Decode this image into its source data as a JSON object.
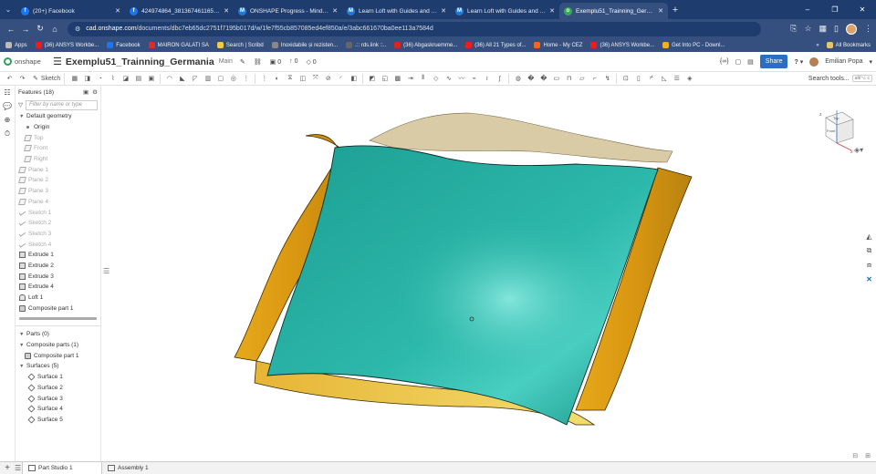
{
  "browser": {
    "tabs": [
      {
        "title": "(20+) Facebook",
        "icon": "facebook-icon",
        "color": "#1877f2",
        "glyph": "f",
        "active": false
      },
      {
        "title": "424974864_381367461165453...",
        "icon": "facebook-icon",
        "color": "#1877f2",
        "glyph": "f",
        "active": false
      },
      {
        "title": "ONSHAPE Progress - Mind Lum...",
        "icon": "mindluster-icon",
        "color": "#1f7ad8",
        "glyph": "M",
        "active": false
      },
      {
        "title": "Learn Loft with Guides and Co...",
        "icon": "mindluster-icon",
        "color": "#1f7ad8",
        "glyph": "M",
        "active": false
      },
      {
        "title": "Learn Loft with Guides and Poi...",
        "icon": "mindluster-icon",
        "color": "#1f7ad8",
        "glyph": "M",
        "active": false
      },
      {
        "title": "Exemplu51_Trainning_Germania...",
        "icon": "onshape-icon",
        "color": "#3aa85a",
        "glyph": "o",
        "active": true
      }
    ],
    "url_prefix": "cad.onshape.com",
    "url_rest": "/documents/dbc7eb65dc2751f7195b017d/w/1fe7f55cb857085ed4ef850a/e/3abc661670ba0ee113a7584d",
    "bookmarks": [
      {
        "label": "Apps",
        "color": "#bbbbbb"
      },
      {
        "label": "(36) ANSYS Workbe...",
        "color": "#e62117"
      },
      {
        "label": "Facebook",
        "color": "#1877f2"
      },
      {
        "label": "MAIRON GALATI SA",
        "color": "#d93025"
      },
      {
        "label": "Search | Scribd",
        "color": "#f2c94c"
      },
      {
        "label": "Inoxidabile și rezisten...",
        "color": "#888888"
      },
      {
        "label": ".:: rds.link ::..",
        "color": "#666666"
      },
      {
        "label": "(36) Abgaskruemme...",
        "color": "#e62117"
      },
      {
        "label": "(36) All 21 Types of...",
        "color": "#e62117"
      },
      {
        "label": "Home - My CEZ",
        "color": "#f26522"
      },
      {
        "label": "(36) ANSYS Workbe...",
        "color": "#e62117"
      },
      {
        "label": "Get Into PC - Downl...",
        "color": "#f2b01e"
      }
    ],
    "all_bookmarks": "All Bookmarks"
  },
  "onshape": {
    "logo_text": "onshape",
    "document_name": "Exemplu51_Trainning_Germania",
    "branch": "Main",
    "header_counts": {
      "versions": "0",
      "branches": "0",
      "comments": "0"
    },
    "share_label": "Share",
    "help_label": "?",
    "user_name": "Emilian Popa",
    "toolbar": {
      "sketch_label": "Sketch",
      "search_label": "Search tools...",
      "search_shortcut": "alt/⌥ c"
    },
    "features_panel": {
      "title": "Features (18)",
      "filter_placeholder": "Filter by name or type",
      "items": [
        {
          "label": "Default geometry",
          "kind": "group",
          "level": 0,
          "dim": false
        },
        {
          "label": "Origin",
          "kind": "dot",
          "level": 1,
          "dim": false
        },
        {
          "label": "Top",
          "kind": "plane",
          "level": 1,
          "dim": true
        },
        {
          "label": "Front",
          "kind": "plane",
          "level": 1,
          "dim": true
        },
        {
          "label": "Right",
          "kind": "plane",
          "level": 1,
          "dim": true
        },
        {
          "label": "Plane 1",
          "kind": "plane",
          "level": 0,
          "dim": true
        },
        {
          "label": "Plane 2",
          "kind": "plane",
          "level": 0,
          "dim": true
        },
        {
          "label": "Plane 3",
          "kind": "plane",
          "level": 0,
          "dim": true
        },
        {
          "label": "Plane 4",
          "kind": "plane",
          "level": 0,
          "dim": true
        },
        {
          "label": "Sketch 1",
          "kind": "sketch",
          "level": 0,
          "dim": true
        },
        {
          "label": "Sketch 2",
          "kind": "sketch",
          "level": 0,
          "dim": true
        },
        {
          "label": "Sketch 3",
          "kind": "sketch",
          "level": 0,
          "dim": true
        },
        {
          "label": "Sketch 4",
          "kind": "sketch",
          "level": 0,
          "dim": true
        },
        {
          "label": "Extrude 1",
          "kind": "extrude",
          "level": 0,
          "dim": false
        },
        {
          "label": "Extrude 2",
          "kind": "extrude",
          "level": 0,
          "dim": false
        },
        {
          "label": "Extrude 3",
          "kind": "extrude",
          "level": 0,
          "dim": false
        },
        {
          "label": "Extrude 4",
          "kind": "extrude",
          "level": 0,
          "dim": false
        },
        {
          "label": "Loft 1",
          "kind": "loft",
          "level": 0,
          "dim": false
        },
        {
          "label": "Composite part 1",
          "kind": "part",
          "level": 0,
          "dim": false
        }
      ],
      "parts_tree": [
        {
          "label": "Parts (0)",
          "kind": "group",
          "level": 0
        },
        {
          "label": "Composite parts (1)",
          "kind": "group",
          "level": 0
        },
        {
          "label": "Composite part 1",
          "kind": "part",
          "level": 1
        },
        {
          "label": "Surfaces (5)",
          "kind": "group",
          "level": 0
        },
        {
          "label": "Surface 1",
          "kind": "surf",
          "level": 2
        },
        {
          "label": "Surface 2",
          "kind": "surf",
          "level": 2
        },
        {
          "label": "Surface 3",
          "kind": "surf",
          "level": 2
        },
        {
          "label": "Surface 4",
          "kind": "surf",
          "level": 2
        },
        {
          "label": "Surface 5",
          "kind": "surf",
          "level": 2
        }
      ]
    },
    "viewcube": {
      "top": "Top",
      "front": "Front",
      "right": "Right"
    },
    "bottom_tabs": [
      {
        "label": "Part Studio 1",
        "active": true
      },
      {
        "label": "Assembly 1",
        "active": false
      }
    ],
    "colors": {
      "teal_surface": "#1fa79a",
      "gold_surface": "#e0a21a",
      "beige_surface": "#d9cba6",
      "accent": "#2b6fbe"
    }
  }
}
